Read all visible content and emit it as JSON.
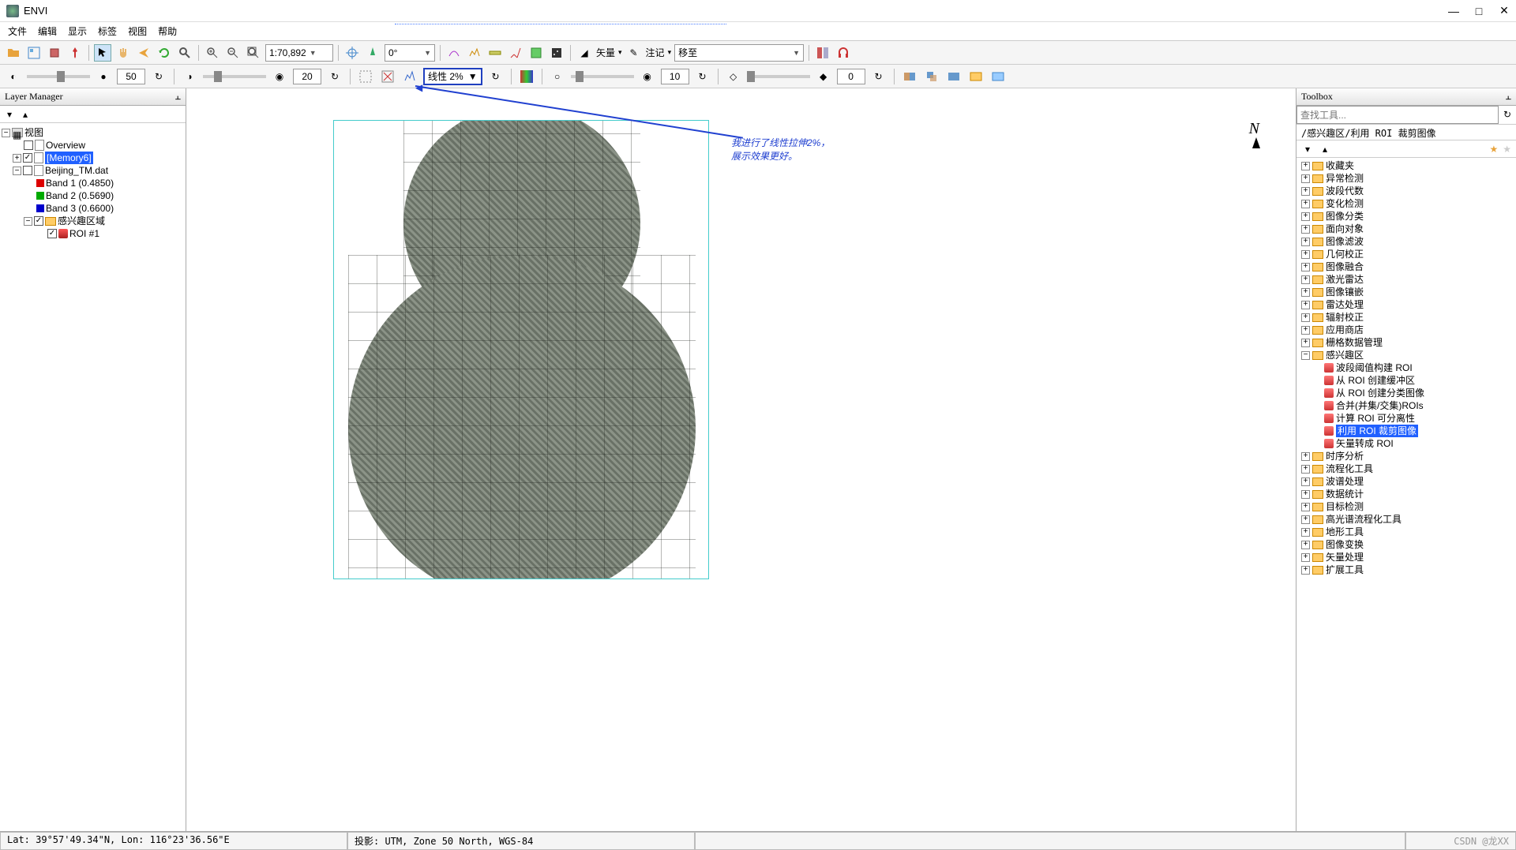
{
  "app": {
    "title": "ENVI"
  },
  "menu": [
    "文件",
    "编辑",
    "显示",
    "标签",
    "视图",
    "帮助"
  ],
  "toolbar1": {
    "scale": "1:70,892",
    "rotation": "0°",
    "vector_label": "矢量",
    "annotate_label": "注记",
    "goto_label": "移至"
  },
  "toolbar2": {
    "bright_val": "50",
    "contrast_val": "20",
    "stretch_label": "线性 2%",
    "sharpen_val": "10",
    "trans_val": "0"
  },
  "layer_panel": {
    "title": "Layer Manager",
    "root": "视图",
    "overview": "Overview",
    "memory": "[Memory6]",
    "dataset": "Beijing_TM.dat",
    "band1": "Band 1 (0.4850)",
    "band2": "Band 2 (0.5690)",
    "band3": "Band 3 (0.6600)",
    "roi_folder": "感兴趣区域",
    "roi1": "ROI #1"
  },
  "annotation": {
    "line1": "我进行了线性拉伸2%，",
    "line2": "展示效果更好。",
    "north": "N"
  },
  "toolbox": {
    "title": "Toolbox",
    "search_ph": "查找工具...",
    "breadcrumb": "/感兴趣区/利用 ROI 裁剪图像",
    "categories": [
      "收藏夹",
      "异常检测",
      "波段代数",
      "变化检测",
      "图像分类",
      "面向对象",
      "图像滤波",
      "几何校正",
      "图像融合",
      "激光雷达",
      "图像镶嵌",
      "雷达处理",
      "辐射校正",
      "应用商店",
      "栅格数据管理"
    ],
    "roi_cat": "感兴趣区",
    "roi_tools": [
      "波段阈值构建 ROI",
      "从 ROI 创建缓冲区",
      "从 ROI 创建分类图像",
      "合并(并集/交集)ROIs",
      "计算 ROI 可分离性",
      "利用 ROI 裁剪图像",
      "矢量转成 ROI"
    ],
    "categories2": [
      "时序分析",
      "流程化工具",
      "波谱处理",
      "数据统计",
      "目标检测",
      "高光谱流程化工具",
      "地形工具",
      "图像变换",
      "矢量处理",
      "扩展工具"
    ]
  },
  "status": {
    "coords": "Lat: 39°57'49.34\"N, Lon: 116°23'36.56\"E",
    "proj": "投影: UTM, Zone 50 North, WGS-84",
    "watermark": "CSDN @龙XX"
  }
}
